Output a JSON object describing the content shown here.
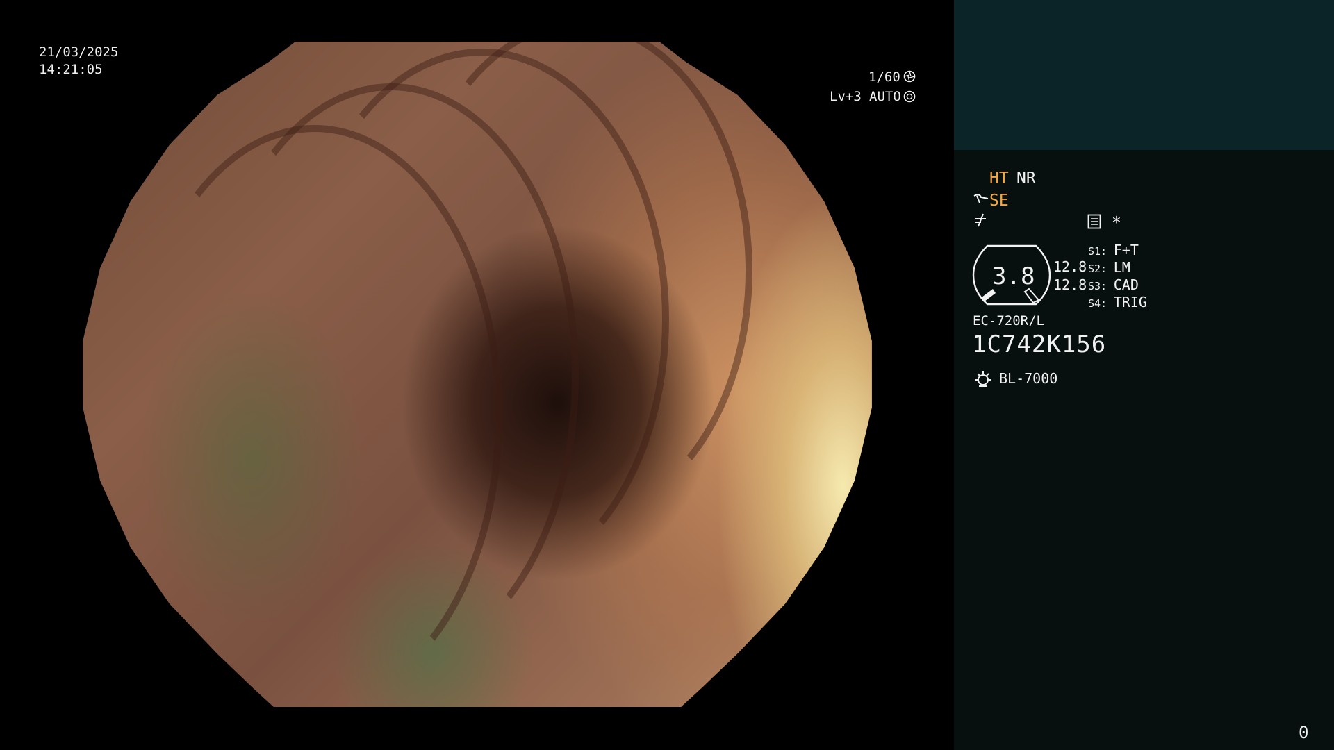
{
  "overlay": {
    "date": "21/03/2025",
    "time": "14:21:05",
    "shutter": "1/60",
    "level": "Lv+3",
    "iris_mode": "AUTO",
    "shutter_icon": "aperture-icon",
    "iris_icon": "iris-icon",
    "counter": "0"
  },
  "panel": {
    "ht": "HT",
    "nr": "NR",
    "se": "SE",
    "se_icon": "scope-tip-icon",
    "enhance_icon": "contrast-icon",
    "settings_icon": "menu-settings-icon",
    "asterisk": "*",
    "gauge_value": "3.8",
    "val_top": "12.8",
    "val_bottom": "12.8",
    "switches": [
      {
        "key": "S1:",
        "value": "F+T"
      },
      {
        "key": "S2:",
        "value": "LM"
      },
      {
        "key": "S3:",
        "value": "CAD"
      },
      {
        "key": "S4:",
        "value": "TRIG"
      }
    ],
    "scope_model": "EC-720R/L",
    "serial": "1C742K156",
    "light_icon": "light-source-icon",
    "light_source": "BL-7000"
  },
  "colors": {
    "accent_orange": "#f7a640",
    "panel_top": "#0b2428",
    "panel_body": "#07100f"
  }
}
